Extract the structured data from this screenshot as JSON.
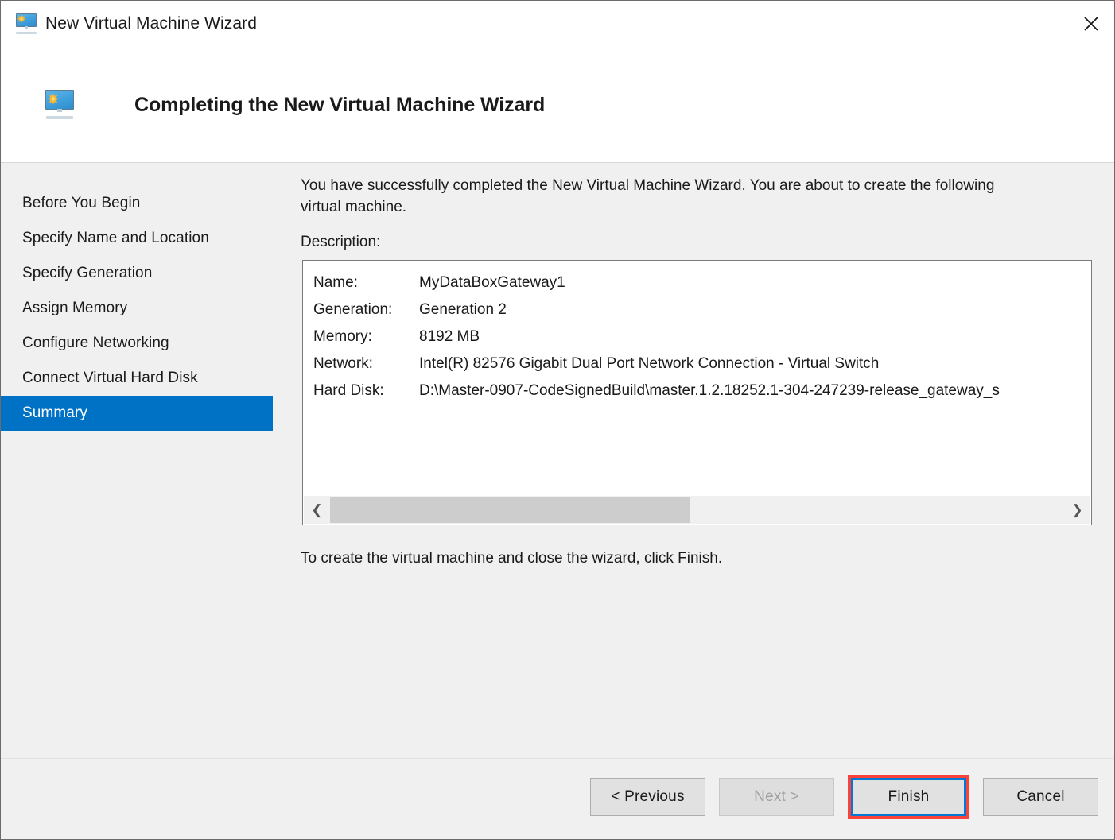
{
  "window": {
    "title": "New Virtual Machine Wizard",
    "title_icon": "virtual-machine-monitor-icon",
    "close_label": "✕"
  },
  "header": {
    "icon": "virtual-machine-monitor-icon",
    "title": "Completing the New Virtual Machine Wizard"
  },
  "sidebar": {
    "items": [
      {
        "label": "Before You Begin",
        "selected": false
      },
      {
        "label": "Specify Name and Location",
        "selected": false
      },
      {
        "label": "Specify Generation",
        "selected": false
      },
      {
        "label": "Assign Memory",
        "selected": false
      },
      {
        "label": "Configure Networking",
        "selected": false
      },
      {
        "label": "Connect Virtual Hard Disk",
        "selected": false
      },
      {
        "label": "Summary",
        "selected": true
      }
    ]
  },
  "content": {
    "intro": "You have successfully completed the New Virtual Machine Wizard. You are about to create the following virtual machine.",
    "description_label": "Description:",
    "summary_rows": [
      {
        "key": "Name:",
        "value": "MyDataBoxGateway1"
      },
      {
        "key": "Generation:",
        "value": "Generation 2"
      },
      {
        "key": "Memory:",
        "value": "8192 MB"
      },
      {
        "key": "Network:",
        "value": "Intel(R) 82576 Gigabit Dual Port Network Connection - Virtual Switch"
      },
      {
        "key": "Hard Disk:",
        "value": "D:\\Master-0907-CodeSignedBuild\\master.1.2.18252.1-304-247239-release_gateway_s"
      }
    ],
    "scrollbar": {
      "left_arrow": "❮",
      "right_arrow": "❯"
    },
    "finish_hint": "To create the virtual machine and close the wizard, click Finish."
  },
  "footer": {
    "buttons": [
      {
        "label": "< Previous",
        "state": "enabled"
      },
      {
        "label": "Next >",
        "state": "disabled"
      },
      {
        "label": "Finish",
        "state": "focused"
      },
      {
        "label": "Cancel",
        "state": "enabled"
      }
    ]
  },
  "colors": {
    "accent_selected": "#0072c6",
    "focus_ring": "#0078d4",
    "annotation_highlight": "#f9423a",
    "panel_bg": "#f0f0f0"
  }
}
